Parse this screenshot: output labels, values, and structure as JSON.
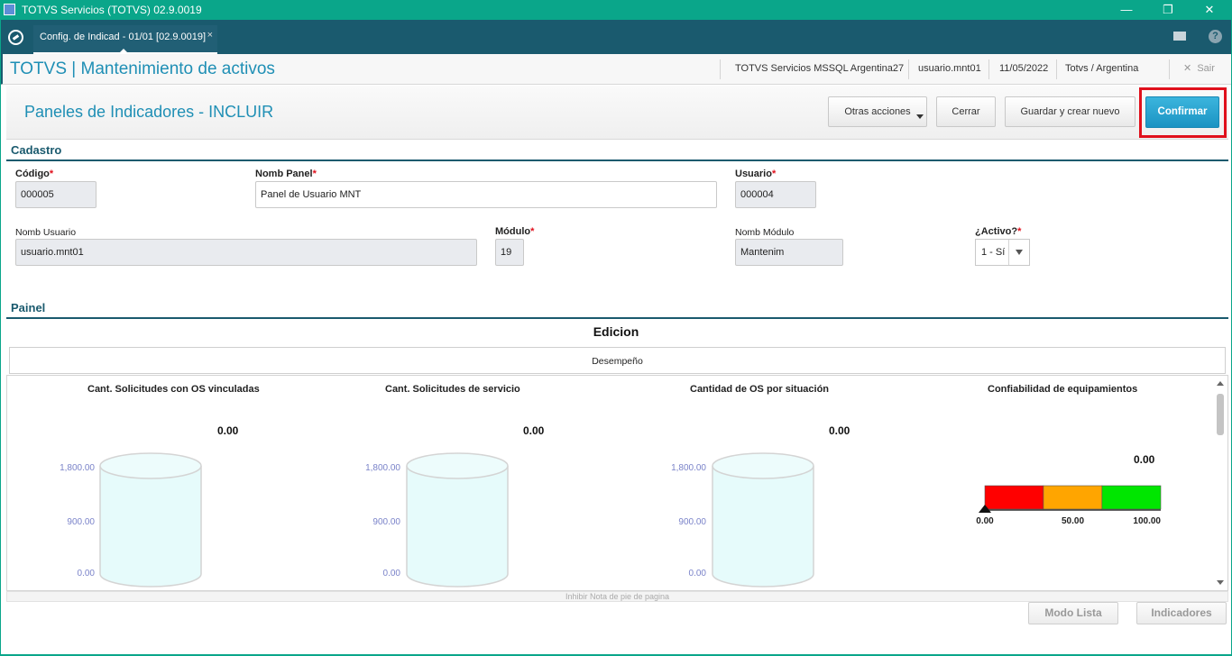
{
  "window": {
    "title": "TOTVS Servicios (TOTVS) 02.9.0019",
    "minimize": "—",
    "restore": "❐",
    "close": "✕",
    "accent_color": "#0aa68a"
  },
  "tabbar": {
    "tab_label": "Config. de Indicad - 01/01 [02.9.0019]",
    "tab_close": "×",
    "help_label": "?"
  },
  "header": {
    "app_title": "TOTVS | Mantenimiento de activos",
    "server": "TOTVS Servicios MSSQL Argentina27",
    "user": "usuario.mnt01",
    "date": "11/05/2022",
    "company": "Totvs / Argentina",
    "exit_label": "Sair"
  },
  "page": {
    "title": "Paneles de Indicadores - INCLUIR",
    "btn_otras": "Otras acciones",
    "btn_cerrar": "Cerrar",
    "btn_guardar": "Guardar y crear nuevo",
    "btn_confirmar": "Confirmar"
  },
  "cadastro": {
    "section_title": "Cadastro",
    "codigo": {
      "label": "Código",
      "value": "000005"
    },
    "nomb_panel": {
      "label": "Nomb Panel",
      "value": "Panel de Usuario MNT"
    },
    "usuario": {
      "label": "Usuario",
      "value": "000004"
    },
    "nomb_usuario": {
      "label": "Nomb Usuario",
      "value": "usuario.mnt01"
    },
    "modulo": {
      "label": "Módulo",
      "value": "19"
    },
    "nomb_modulo": {
      "label": "Nomb Módulo",
      "value": "Mantenim"
    },
    "activo": {
      "label": "¿Activo?",
      "value": "1 - Sí"
    },
    "required_mark": "*"
  },
  "painel": {
    "section_title": "Painel",
    "edicion": "Edicion",
    "tab_label": "Desempeño",
    "footer_note": "Inhibir Nota de pie de pagina",
    "btn_modo_lista": "Modo Lista",
    "btn_indicadores": "Indicadores"
  },
  "chart_data": [
    {
      "type": "cylinder-gauge",
      "title": "Cant. Solicitudes con OS vinculadas",
      "value_label": "0.00",
      "value": 0,
      "ticks": [
        "1,800.00",
        "900.00",
        "0.00"
      ],
      "ylim": [
        0,
        1800
      ]
    },
    {
      "type": "cylinder-gauge",
      "title": "Cant. Solicitudes de servicio",
      "value_label": "0.00",
      "value": 0,
      "ticks": [
        "1,800.00",
        "900.00",
        "0.00"
      ],
      "ylim": [
        0,
        1800
      ]
    },
    {
      "type": "cylinder-gauge",
      "title": "Cantidad de OS por situación",
      "value_label": "0.00",
      "value": 0,
      "ticks": [
        "1,800.00",
        "900.00",
        "0.00"
      ],
      "ylim": [
        0,
        1800
      ]
    },
    {
      "type": "linear-gauge",
      "title": "Confiabilidad de equipamientos",
      "value_label": "0.00",
      "value": 0,
      "range": [
        0,
        100
      ],
      "bands": [
        {
          "from": 0,
          "to": 33.3,
          "color": "#ff0000"
        },
        {
          "from": 33.3,
          "to": 66.6,
          "color": "#ffa500"
        },
        {
          "from": 66.6,
          "to": 100,
          "color": "#00e600"
        }
      ],
      "tick_labels": [
        "0.00",
        "50.00",
        "100.00"
      ]
    }
  ]
}
